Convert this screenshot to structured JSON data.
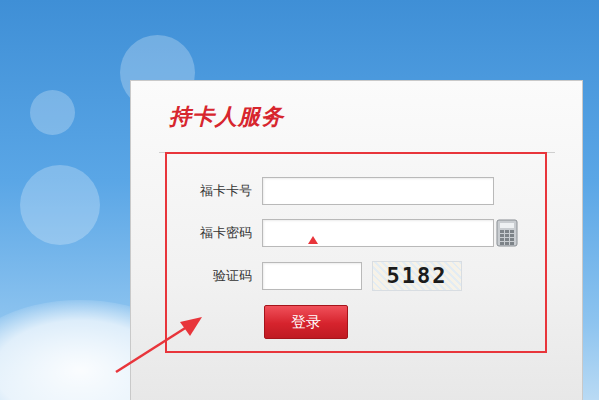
{
  "panel": {
    "title": "持卡人服务"
  },
  "fields": [
    {
      "label": "福卡卡号",
      "kind": "text"
    },
    {
      "label": "福卡密码",
      "kind": "password"
    },
    {
      "label": "验证码",
      "kind": "captcha"
    }
  ],
  "captcha": {
    "code": "5182"
  },
  "buttons": [
    "登录"
  ]
}
